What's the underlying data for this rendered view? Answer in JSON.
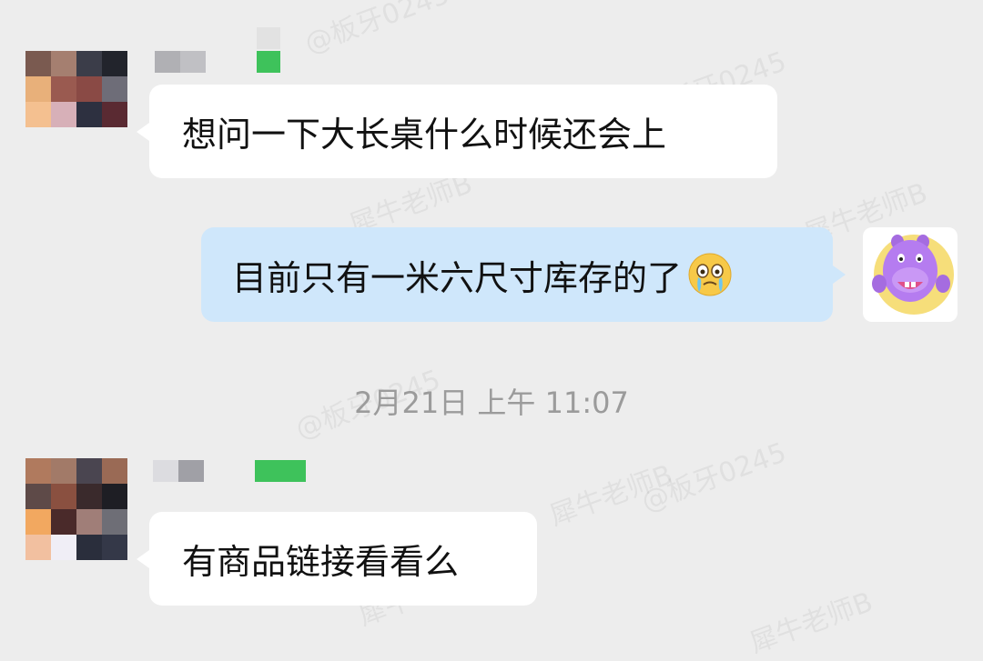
{
  "watermark": {
    "text_a": "犀牛老师B",
    "text_b": "@板牙0245"
  },
  "messages": [
    {
      "side": "left",
      "text": "想问一下大长桌什么时候还会上"
    },
    {
      "side": "right",
      "text": "目前只有一米六尺寸库存的了",
      "emoji": "crying-face"
    },
    {
      "side": "left",
      "text": "有商品链接看看么"
    }
  ],
  "timestamp": "2月21日  上午 11:07",
  "colors": {
    "background": "#ededed",
    "left_bubble": "#ffffff",
    "right_bubble": "#cfe7fb",
    "name_tag": "#3ec25b"
  },
  "icons": {
    "sender_avatar": "pixelated-avatar-icon",
    "self_avatar": "purple-hippo-mascot-icon"
  }
}
